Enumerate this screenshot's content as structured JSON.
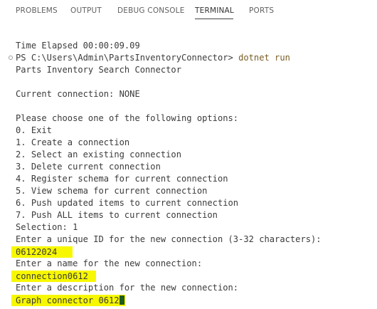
{
  "panel": {
    "tabs": [
      {
        "label": "PROBLEMS",
        "active": false
      },
      {
        "label": "OUTPUT",
        "active": false
      },
      {
        "label": "DEBUG CONSOLE",
        "active": false
      },
      {
        "label": "TERMINAL",
        "active": true
      },
      {
        "label": "PORTS",
        "active": false
      }
    ]
  },
  "terminal": {
    "time_elapsed": "Time Elapsed 00:00:09.09",
    "prompt": {
      "path": "PS C:\\Users\\Admin\\PartsInventoryConnector> ",
      "command": "dotnet run"
    },
    "app_title": "Parts Inventory Search Connector",
    "current_connection": "Current connection: NONE",
    "menu_prompt": "Please choose one of the following options:",
    "options": [
      "0. Exit",
      "1. Create a connection",
      "2. Select an existing connection",
      "3. Delete current connection",
      "4. Register schema for current connection",
      "5. View schema for current connection",
      "6. Push updated items to current connection",
      "7. Push ALL items to current connection"
    ],
    "selection": "Selection: 1",
    "id_prompt": "Enter a unique ID for the new connection (3-32 characters):",
    "id_value": "06122024",
    "name_prompt": "Enter a name for the new connection:",
    "name_value": "connection0612",
    "description_prompt": "Enter a description for the new connection:",
    "description_value": "Graph connector 0612"
  },
  "colors": {
    "highlight": "#fcff00",
    "command": "#795e26",
    "text": "#3b3b3b",
    "cursor": "#1f5c1f"
  }
}
